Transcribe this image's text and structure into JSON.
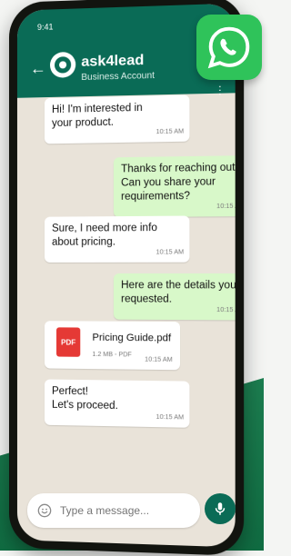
{
  "status": {
    "time": "9:41"
  },
  "header": {
    "contact_name": "ask4lead",
    "contact_subtitle": "Business Account"
  },
  "messages": [
    {
      "direction": "in",
      "text": "Hi! I'm interested in\nyour product.",
      "time": "10:15 AM"
    },
    {
      "direction": "out",
      "text": "Thanks for reaching out!\nCan you share your\nrequirements?",
      "time": "10:15 AM"
    },
    {
      "direction": "in",
      "text": "Sure, I need more info\nabout pricing.",
      "time": "10:15 AM"
    },
    {
      "direction": "out",
      "text": "Here are the details you\nrequested.",
      "time": "10:15 AM"
    },
    {
      "direction": "in",
      "text": "Perfect!\nLet's proceed.",
      "time": "10:15 AM"
    }
  ],
  "attachment": {
    "filename": "Pricing Guide.pdf",
    "meta": "1.2 MB - PDF",
    "time": "10:15 AM",
    "icon_label": "PDF"
  },
  "composer": {
    "placeholder": "Type a message..."
  },
  "icons": [
    "back-arrow-icon",
    "avatar",
    "more-options-icon",
    "whatsapp-logo-icon",
    "emoji-icon",
    "microphone-icon",
    "pdf-file-icon"
  ],
  "colors": {
    "header": "#0a6b56",
    "outgoing_bubble": "#d8f8c9",
    "incoming_bubble": "#ffffff",
    "whatsapp_green": "#2fc35a",
    "pdf_red": "#e53935"
  }
}
